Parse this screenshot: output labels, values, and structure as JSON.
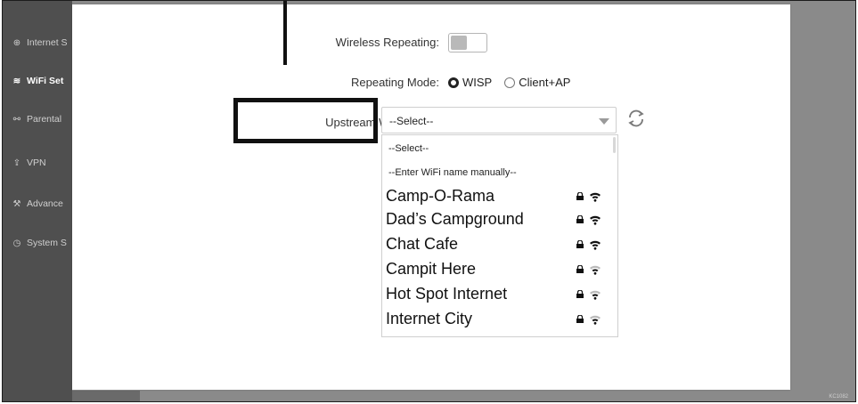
{
  "sidebar": {
    "items": [
      {
        "label": "Internet S",
        "icon": "globe-icon",
        "glyph": "⊕"
      },
      {
        "label": "WiFi Set",
        "icon": "wifi-icon",
        "glyph": "≋"
      },
      {
        "label": "Parental",
        "icon": "parental-icon",
        "glyph": "⚯"
      },
      {
        "label": "VPN",
        "icon": "vpn-icon",
        "glyph": "⇪"
      },
      {
        "label": "Advance",
        "icon": "wrench-icon",
        "glyph": "⚒"
      },
      {
        "label": "System S",
        "icon": "clock-icon",
        "glyph": "◷"
      }
    ],
    "active_index": 1
  },
  "form": {
    "wireless_repeating_label": "Wireless Repeating:",
    "wireless_repeating_enabled": false,
    "repeating_mode_label": "Repeating Mode:",
    "repeating_mode_options": [
      "WISP",
      "Client+AP"
    ],
    "repeating_mode_selected": "WISP",
    "upstream_label": "Upstream WiFi Name:",
    "upstream_value": "--Select--"
  },
  "dropdown": {
    "small_options": [
      "--Select--",
      "--Enter WiFi name manually--"
    ],
    "networks": [
      {
        "name": "Camp-O-Rama"
      },
      {
        "name": "Dad’s Campground"
      },
      {
        "name": "Chat Cafe"
      },
      {
        "name": "Campit Here"
      },
      {
        "name": "Hot Spot Internet"
      },
      {
        "name": "Internet City"
      }
    ]
  },
  "footer_code": "KC1082",
  "colors": {
    "sidebar": "#4f4f4f",
    "backdrop": "#8a8a8a",
    "callout": "#111111"
  }
}
